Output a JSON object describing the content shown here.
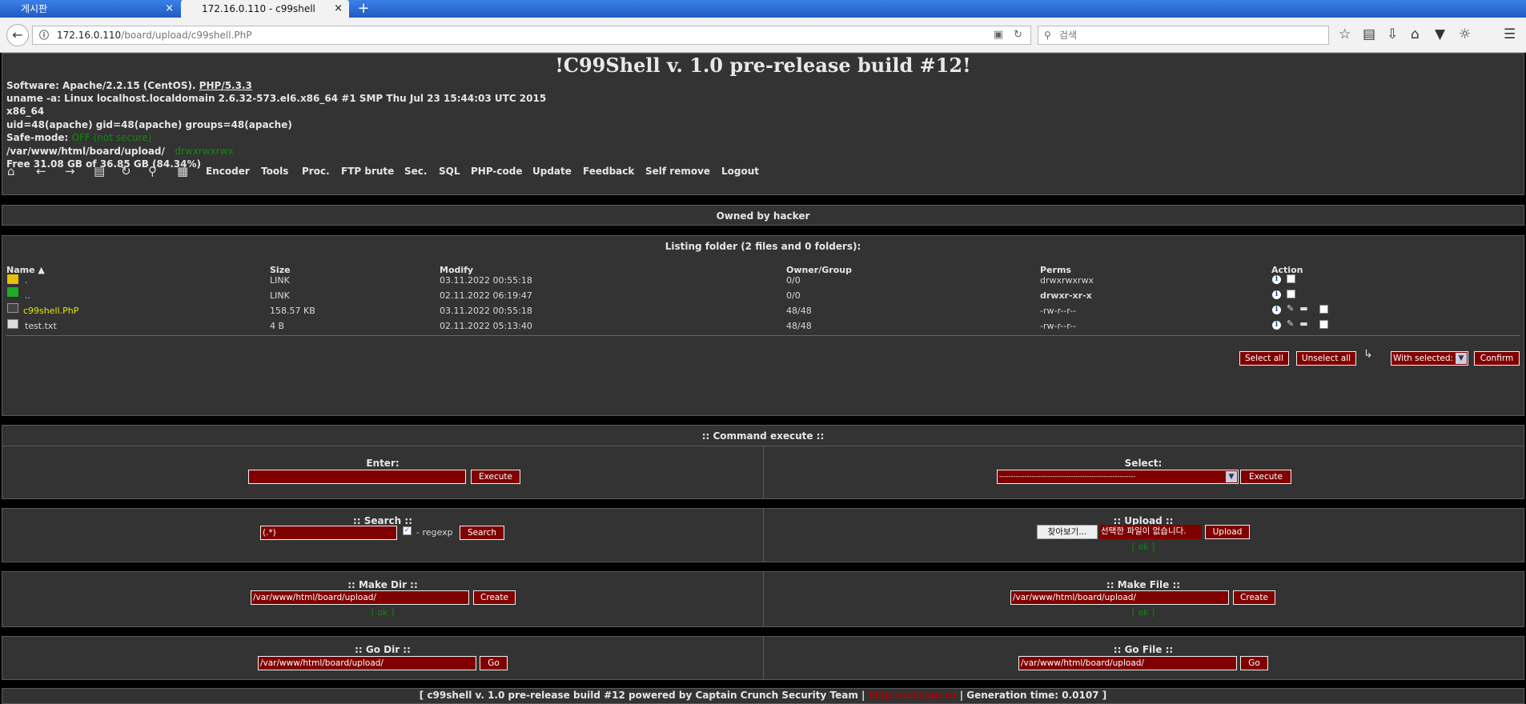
{
  "browser": {
    "tabs": [
      {
        "label": "게시판"
      },
      {
        "label": "172.16.0.110 - c99shell"
      }
    ],
    "tab_close": "×",
    "new_tab": "+",
    "url_host": "172.16.0.110",
    "url_path": "/board/upload/c99shell.PhP",
    "search_placeholder": "검색"
  },
  "header": {
    "title": "!C99Shell v. 1.0 pre-release build #12!",
    "software_prefix": "Software: Apache/2.2.15 (CentOS). ",
    "software_link": "PHP/5.3.3",
    "uname": "uname -a: Linux localhost.localdomain 2.6.32-573.el6.x86_64 #1 SMP Thu Jul 23 15:44:03 UTC 2015",
    "arch": "x86_64",
    "uid": "uid=48(apache) gid=48(apache) groups=48(apache)",
    "safe_label": "Safe-mode: ",
    "safe_value": "OFF (not secure)",
    "path": "/var/www/html/board/upload/",
    "path_perms": "drwxrwxrwx",
    "free": "Free 31.08 GB of 36.85 GB (84.34%)",
    "menu": [
      "Encoder",
      "Tools",
      "Proc.",
      "FTP brute",
      "Sec.",
      "SQL",
      "PHP-code",
      "Update",
      "Feedback",
      "Self remove",
      "Logout"
    ]
  },
  "owned": "Owned by hacker",
  "listing": {
    "title": "Listing folder (2 files and 0 folders):",
    "columns": [
      "Name ▲",
      "Size",
      "Modify",
      "Owner/Group",
      "Perms",
      "Action"
    ],
    "rows": [
      {
        "name": ".",
        "size": "LINK",
        "modify": "03.11.2022 00:55:18",
        "owner": "0/0",
        "perms": "drwxrwxrwx",
        "perm_color": "#0c8a0c"
      },
      {
        "name": "..",
        "size": "LINK",
        "modify": "02.11.2022 06:19:47",
        "owner": "0/0",
        "perms": "drwxr-xr-x",
        "perm_color": "#ffffff"
      },
      {
        "name": "c99shell.PhP",
        "size": "158.57 KB",
        "modify": "03.11.2022 00:55:18",
        "owner": "48/48",
        "perms": "-rw-r--r--",
        "perm_color": "#0c8a0c"
      },
      {
        "name": "test.txt",
        "size": "4 B",
        "modify": "02.11.2022 05:13:40",
        "owner": "48/48",
        "perms": "-rw-r--r--",
        "perm_color": "#0c8a0c"
      }
    ],
    "select_all": "Select all",
    "unselect_all": "Unselect all",
    "with_selected": "With selected:",
    "confirm": "Confirm"
  },
  "cmd": {
    "title": ":: Command execute ::",
    "enter_label": "Enter:",
    "execute": "Execute",
    "select_label": "Select:",
    "select_value": "-----------------------------------------------------------"
  },
  "search": {
    "label": ":: Search ::",
    "value": "(.*)",
    "regexp": "- regexp",
    "button": "Search"
  },
  "upload": {
    "label": ":: Upload ::",
    "browse": "찾아보기...",
    "nofile": "선택한 파일이 없습니다.",
    "button": "Upload",
    "ok": "[ ok ]"
  },
  "makedir": {
    "label": ":: Make Dir ::",
    "value": "/var/www/html/board/upload/",
    "button": "Create",
    "ok": "[ ok ]"
  },
  "makefile": {
    "label": ":: Make File ::",
    "value": "/var/www/html/board/upload/",
    "button": "Create",
    "ok": "[ ok ]"
  },
  "godir": {
    "label": ":: Go Dir ::",
    "value": "/var/www/html/board/upload/",
    "button": "Go"
  },
  "gofile": {
    "label": ":: Go File ::",
    "value": "/var/www/html/board/upload/",
    "button": "Go"
  },
  "footer": {
    "prefix": "[ c99shell v. 1.0 pre-release build #12 powered by Captain Crunch Security Team | ",
    "link": "http://ccteam.ru",
    "suffix": " | Generation time: 0.0107 ]"
  }
}
